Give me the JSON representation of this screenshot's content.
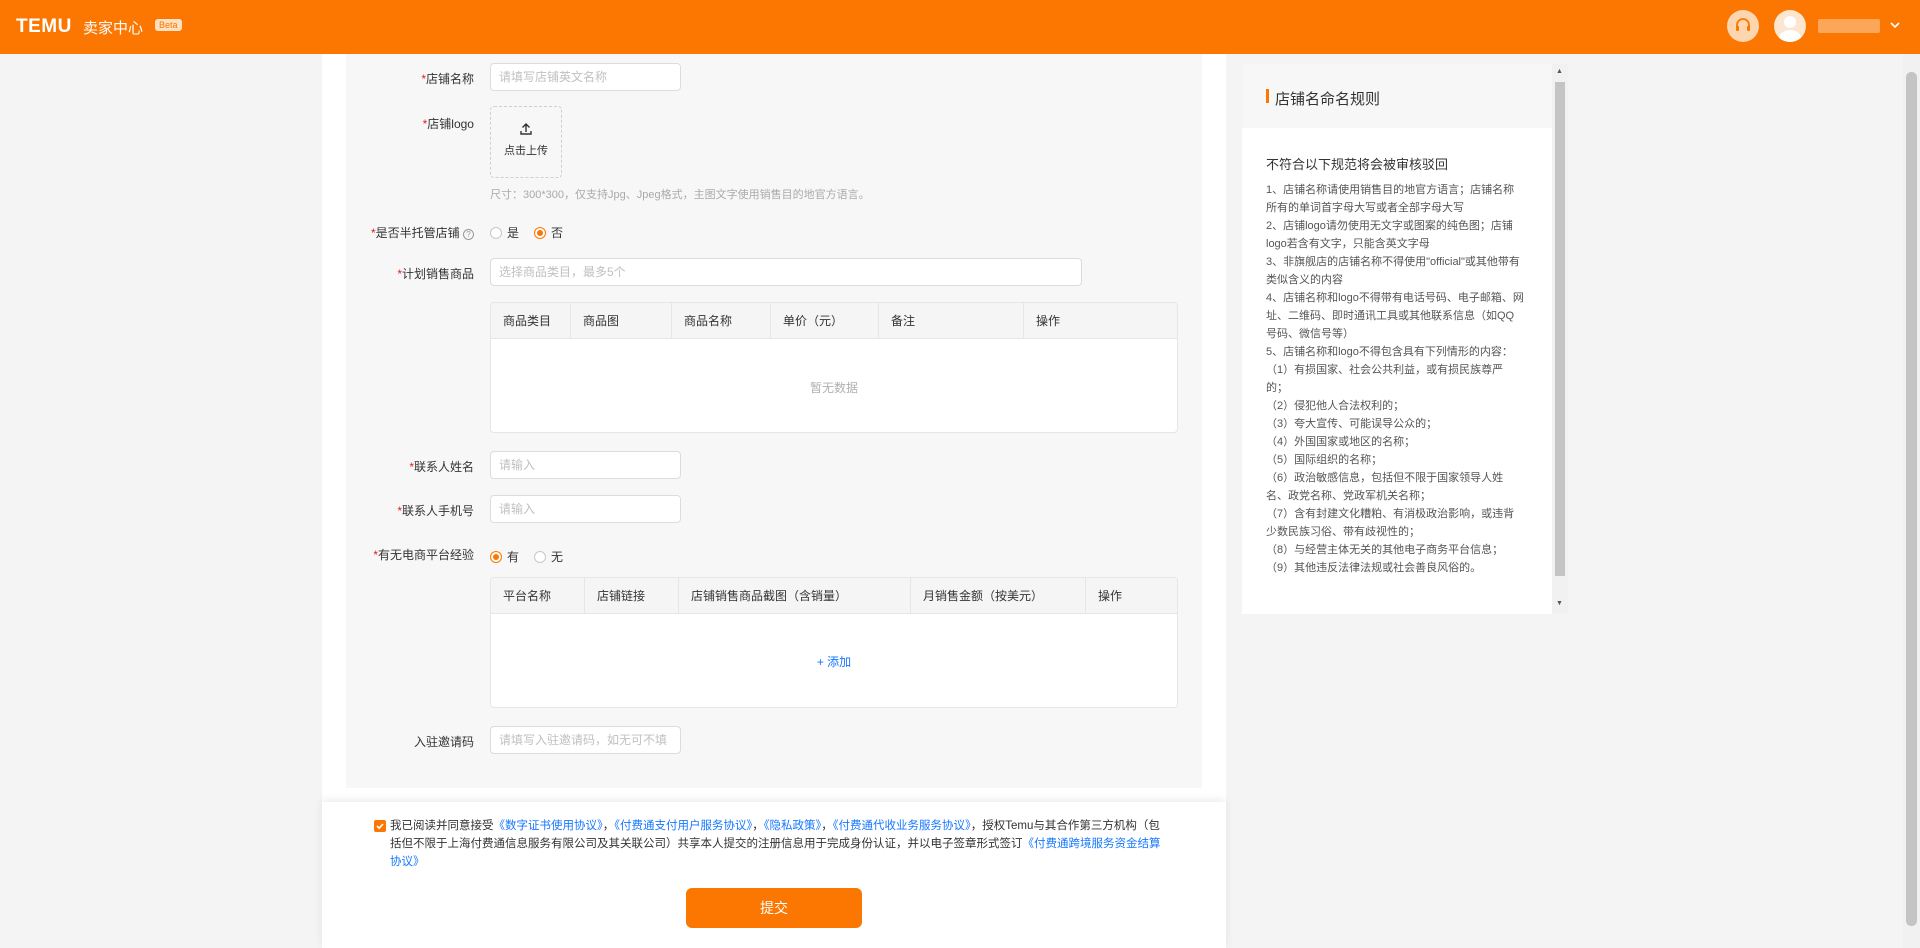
{
  "header": {
    "logo": "TEMU",
    "app_name": "卖家中心",
    "badge": "Beta",
    "icons": {
      "support": "headset-icon",
      "avatar": "user-avatar-icon",
      "menu": "chevron-down-icon"
    },
    "brand_color": "#fb7701"
  },
  "form": {
    "store_name": {
      "label": "店铺名称",
      "placeholder": "请填写店铺英文名称"
    },
    "store_logo": {
      "label": "店铺logo",
      "upload_text": "点击上传",
      "hint": "尺寸：300*300，仅支持Jpg、Jpeg格式，主图文字使用销售目的地官方语言。"
    },
    "semi_managed": {
      "label": "是否半托管店铺",
      "options": [
        "是",
        "否"
      ],
      "selected": "否"
    },
    "planned_products": {
      "label": "计划销售商品",
      "placeholder": "选择商品类目，最多5个",
      "columns": [
        "商品类目",
        "商品图",
        "商品名称",
        "单价（元）",
        "备注",
        "操作"
      ],
      "empty_text": "暂无数据"
    },
    "contact_name": {
      "label": "联系人姓名",
      "placeholder": "请输入"
    },
    "contact_phone": {
      "label": "联系人手机号",
      "placeholder": "请输入"
    },
    "ecommerce_experience": {
      "label": "有无电商平台经验",
      "options": [
        "有",
        "无"
      ],
      "selected": "有",
      "columns": [
        "平台名称",
        "店铺链接",
        "店铺销售商品截图（含销量）",
        "月销售金额（按美元）",
        "操作"
      ],
      "add_label": "+ 添加"
    },
    "invite_code": {
      "label": "入驻邀请码",
      "placeholder": "请填写入驻邀请码，如无可不填"
    }
  },
  "rules": {
    "title": "店铺名命名规则",
    "subtitle": "不符合以下规范将会被审核驳回",
    "items": [
      "1、店铺名称请使用销售目的地官方语言；店铺名称所有的单词首字母大写或者全部字母大写",
      "2、店铺logo请勿使用无文字或图案的纯色图；店铺logo若含有文字，只能含英文字母",
      "3、非旗舰店的店铺名称不得使用\"official\"或其他带有类似含义的内容",
      "4、店铺名称和logo不得带有电话号码、电子邮箱、网址、二维码、即时通讯工具或其他联系信息（如QQ号码、微信号等）",
      "5、店铺名称和logo不得包含具有下列情形的内容：",
      "（1）有损国家、社会公共利益，或有损民族尊严的；",
      "（2）侵犯他人合法权利的；",
      "（3）夸大宣传、可能误导公众的；",
      "（4）外国国家或地区的名称；",
      "（5）国际组织的名称；",
      "（6）政治敏感信息，包括但不限于国家领导人姓名、政党名称、党政军机关名称；",
      "（7）含有封建文化糟粕、有消极政治影响，或违背少数民族习俗、带有歧视性的；",
      "（8）与经营主体无关的其他电子商务平台信息；",
      "（9）其他违反法律法规或社会善良风俗的。"
    ]
  },
  "agreement": {
    "checked": true,
    "prefix": "我已阅读并同意接受",
    "link1": "《数字证书使用协议》",
    "sep1": "，",
    "link2": "《付费通支付用户服务协议》",
    "sep2": "，",
    "link3": "《隐私政策》",
    "sep3": "，",
    "link4": "《付费通代收业务服务协议》",
    "middle": "，授权Temu与其合作第三方机构（包括但不限于上海付费通信息服务有限公司及其关联公司）共享本人提交的注册信息用于完成身份认证，并以电子签章形式签订",
    "link5": "《付费通跨境服务资金结算协议》",
    "submit_label": "提交"
  }
}
